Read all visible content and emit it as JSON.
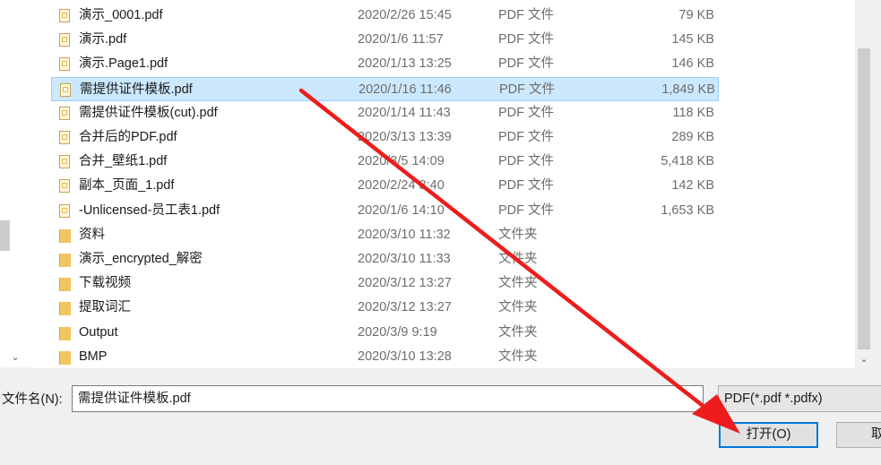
{
  "files": [
    {
      "name": "演示_0001.pdf",
      "date": "2020/2/26 15:45",
      "type": "PDF 文件",
      "size": "79 KB",
      "icon": "pdf-file-icon"
    },
    {
      "name": "演示.pdf",
      "date": "2020/1/6 11:57",
      "type": "PDF 文件",
      "size": "145 KB",
      "icon": "pdf-file-icon"
    },
    {
      "name": "演示.Page1.pdf",
      "date": "2020/1/13 13:25",
      "type": "PDF 文件",
      "size": "146 KB",
      "icon": "pdf-file-icon"
    },
    {
      "name": "需提供证件模板.pdf",
      "date": "2020/1/16 11:46",
      "type": "PDF 文件",
      "size": "1,849 KB",
      "icon": "pdf-file-icon",
      "selected": true
    },
    {
      "name": "需提供证件模板(cut).pdf",
      "date": "2020/1/14 11:43",
      "type": "PDF 文件",
      "size": "118 KB",
      "icon": "pdf-file-icon"
    },
    {
      "name": "合并后的PDF.pdf",
      "date": "2020/3/13 13:39",
      "type": "PDF 文件",
      "size": "289 KB",
      "icon": "pdf-file-icon"
    },
    {
      "name": "合并_壁纸1.pdf",
      "date": "2020/3/5 14:09",
      "type": "PDF 文件",
      "size": "5,418 KB",
      "icon": "pdf-file-icon"
    },
    {
      "name": "副本_页面_1.pdf",
      "date": "2020/2/24 8:40",
      "type": "PDF 文件",
      "size": "142 KB",
      "icon": "pdf-file-icon"
    },
    {
      "name": "-Unlicensed-员工表1.pdf",
      "date": "2020/1/6 14:10",
      "type": "PDF 文件",
      "size": "1,653 KB",
      "icon": "pdf-file-icon"
    },
    {
      "name": "资料",
      "date": "2020/3/10 11:32",
      "type": "文件夹",
      "size": "",
      "icon": "folder-icon"
    },
    {
      "name": "演示_encrypted_解密",
      "date": "2020/3/10 11:33",
      "type": "文件夹",
      "size": "",
      "icon": "folder-icon"
    },
    {
      "name": "下载视频",
      "date": "2020/3/12 13:27",
      "type": "文件夹",
      "size": "",
      "icon": "folder-icon"
    },
    {
      "name": "提取词汇",
      "date": "2020/3/12 13:27",
      "type": "文件夹",
      "size": "",
      "icon": "folder-icon"
    },
    {
      "name": "Output",
      "date": "2020/3/9 9:19",
      "type": "文件夹",
      "size": "",
      "icon": "folder-icon"
    },
    {
      "name": "BMP",
      "date": "2020/3/10 13:28",
      "type": "文件夹",
      "size": "",
      "icon": "folder-icon"
    }
  ],
  "filename_label": "文件名(N):",
  "filename_value": "需提供证件模板.pdf",
  "filetype_value": "PDF(*.pdf *.pdfx)",
  "open_label": "打开(O)",
  "cancel_label": "取",
  "scroll_down_glyph": "⌄",
  "colors": {
    "selection": "#cce8ff",
    "selection_border": "#99d1ff",
    "annotation_arrow": "#ee1c1c",
    "open_button_border": "#0078d7"
  }
}
